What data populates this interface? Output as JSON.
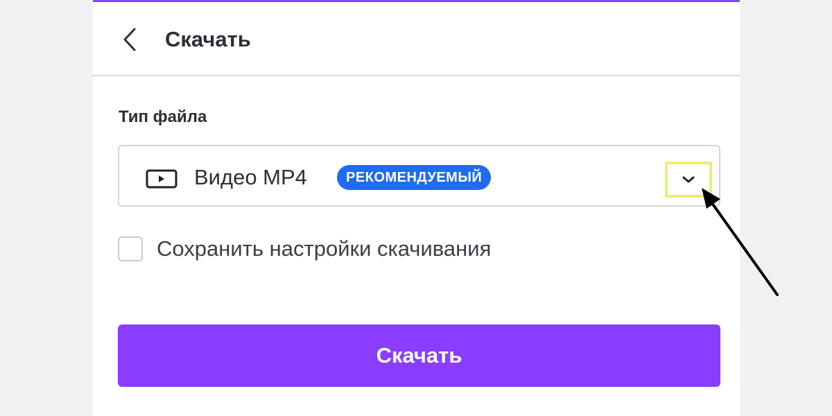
{
  "header": {
    "title": "Скачать",
    "back_icon": "chevron-left-icon"
  },
  "file_type": {
    "label": "Тип файла",
    "selected_value": "Видео MP4",
    "selected_icon": "video-icon",
    "badge": "РЕКОМЕНДУЕМЫЙ",
    "dropdown_icon": "chevron-down-icon"
  },
  "save_settings": {
    "label": "Сохранить настройки скачивания",
    "checked": false
  },
  "download_button": {
    "label": "Скачать"
  },
  "colors": {
    "accent": "#8b3dff",
    "badge": "#1f6bf2",
    "highlight": "#eded70"
  }
}
